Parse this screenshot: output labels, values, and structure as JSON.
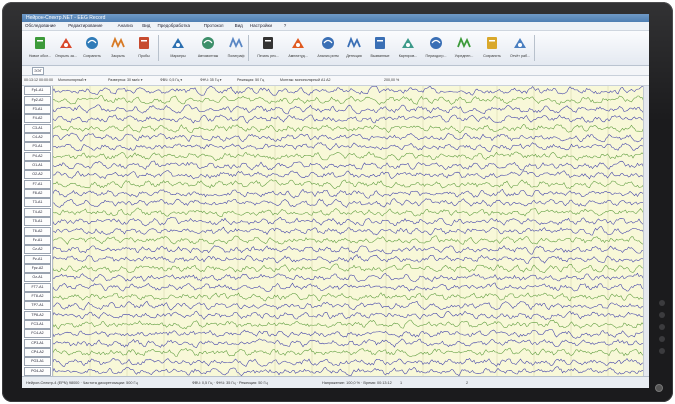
{
  "app": {
    "title": "Нейрон-Спектр.NET - EEG Record"
  },
  "menu": [
    "Обследование",
    "Редактирование",
    "Анализ",
    "Вид",
    "Предобработка",
    "Протокол",
    "Вид",
    "Настройки",
    "?"
  ],
  "toolbar": [
    {
      "label": "Новое обсл...",
      "icon": "new-exam-icon",
      "color": "#3c9a3a"
    },
    {
      "label": "Открыть за...",
      "icon": "open-record-icon",
      "color": "#d9482b"
    },
    {
      "label": "Сохранить",
      "icon": "save-icon",
      "color": "#2f7bb8"
    },
    {
      "label": "Закрыть",
      "icon": "close-exam-icon",
      "color": "#d77a25"
    },
    {
      "label": "Пробы",
      "icon": "tests-icon",
      "color": "#c74b2f"
    },
    {
      "label": "Маркеры",
      "icon": "markers-icon",
      "color": "#2b6fb0"
    },
    {
      "label": "Автомонтаж",
      "icon": "automontage-icon",
      "color": "#3c8f6a"
    },
    {
      "label": "Полиграф",
      "icon": "polygraph-icon",
      "color": "#5a87c4"
    },
    {
      "label": "Печать рез...",
      "icon": "print-icon",
      "color": "#333333"
    },
    {
      "label": "Амплитуд...",
      "icon": "amplitude-icon",
      "color": "#e05a20"
    },
    {
      "label": "Анализ ритм",
      "icon": "rhythm-analysis-icon",
      "color": "#3a6fb5"
    },
    {
      "label": "Детекция",
      "icon": "detection-icon",
      "color": "#3a6fb5"
    },
    {
      "label": "Вызванные",
      "icon": "evoked-icon",
      "color": "#3a6fb5"
    },
    {
      "label": "Картиров...",
      "icon": "mapping-icon",
      "color": "#3c9a8a"
    },
    {
      "label": "Периодогр...",
      "icon": "periodogram-icon",
      "color": "#3a6fb5"
    },
    {
      "label": "Усреднен...",
      "icon": "averaging-icon",
      "color": "#3c9a3a"
    },
    {
      "label": "Сохранить",
      "icon": "save-result-icon",
      "color": "#d9a82b"
    },
    {
      "label": "Отчёт раб...",
      "icon": "report-icon",
      "color": "#4a7fc0"
    }
  ],
  "subbar": {
    "tab": "ЭЭГ"
  },
  "controls": {
    "time": "00:13:12  00:00:00",
    "montage": "Монополярный ▾",
    "speed": "Развертка: 30 мм/с ▾",
    "sens": "ФВЧ: 0,5 Гц ▾",
    "filter": "ФНЧ: 35 Гц ▾",
    "notch": "Режекция: 50 Гц",
    "ref": "Монтаж: монополярный A1 A2",
    "zoom": "200,00 %"
  },
  "channels": [
    "Fp1-A1",
    "Fp2-A2",
    "F3-A1",
    "F4-A2",
    "C3-A1",
    "C4-A2",
    "P3-A1",
    "P4-A2",
    "O1-A1",
    "O2-A2",
    "F7-A1",
    "F8-A2",
    "T3-A1",
    "T4-A2",
    "T5-A1",
    "T6-A2",
    "Fz-A1",
    "Cz-A2",
    "Pz-A1",
    "Fpz-A2",
    "Oz-A1",
    "FT7-A1",
    "FT8-A2",
    "TP7-A1",
    "TP8-A2",
    "FC3-A1",
    "FC4-A2",
    "CP3-A1",
    "CP4-A2",
    "PO3-A1",
    "PO4-A2"
  ],
  "page_markers": [
    "1",
    "2"
  ],
  "status": {
    "left": "Нейрон-Спектр-4 (EPN) 98000 · Частота дискретизации: 500 Гц",
    "middle": "ФВЧ: 0,5 Гц · ФНЧ: 35 Гц · Режекция: 50 Гц",
    "right": "Напряжение: 100,0 % · Время: 00:13:12"
  },
  "colors": {
    "trace_even": "#3c3ca8",
    "trace_odd": "#5a9a3a",
    "plot_bg": "#f8f8d8",
    "grid": "#c8c89a"
  }
}
